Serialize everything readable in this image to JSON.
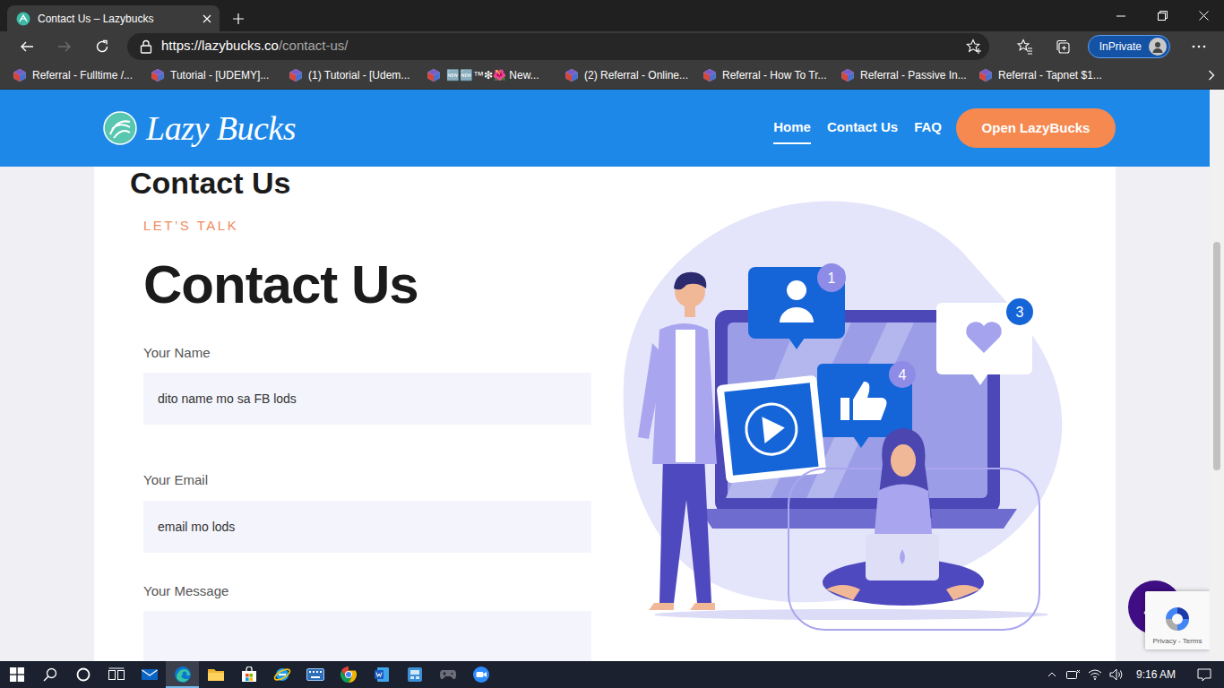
{
  "tabs": [
    {
      "label": "Contact Us – Lazybucks",
      "selected": true
    }
  ],
  "toolbar": {
    "back_enabled": true,
    "forward_enabled": false,
    "url_host": "https://lazybucks.co",
    "url_path": "/contact-us/",
    "profile": "InPrivate"
  },
  "favorites": [
    "Referral - Fulltime /...",
    "Tutorial - [UDEMY]...",
    "(1) Tutorial - [Udem...",
    "🆕🆕™❇🌺 New...",
    "(2) Referral - Online...",
    "Referral - How To Tr...",
    "Referral - Passive In...",
    "Referral - Tapnet $1..."
  ],
  "site": {
    "logo": "Lazy Bucks",
    "nav": [
      {
        "label": "Home",
        "selected": true
      },
      {
        "label": "Contact Us",
        "selected": false
      },
      {
        "label": "FAQ",
        "selected": false
      }
    ],
    "cta": "Open LazyBucks"
  },
  "contact": {
    "page_title": "Contact Us",
    "eyebrow": "LET’S TALK",
    "heading": "Contact Us",
    "fields": [
      {
        "label": "Your Name",
        "value": "dito name mo sa FB lods",
        "kind": "input"
      },
      {
        "label": "Your Email",
        "value": "email mo lods",
        "kind": "input"
      },
      {
        "label": "Your Message",
        "value": "",
        "kind": "textarea"
      }
    ]
  },
  "illustration": {
    "badges": [
      {
        "text": "1",
        "color": "#8e8ce6"
      },
      {
        "text": "3",
        "color": "#1565d8"
      },
      {
        "text": "4",
        "color": "#8e8ce6"
      }
    ]
  },
  "recaptcha": {
    "links": "Privacy - Terms"
  },
  "taskbar": {
    "apps": [
      {
        "selected": false
      },
      {
        "selected": false
      },
      {
        "selected": false
      },
      {
        "selected": false
      },
      {
        "selected": false
      },
      {
        "selected": true
      },
      {
        "selected": false
      },
      {
        "selected": false
      },
      {
        "selected": false
      },
      {
        "selected": false
      },
      {
        "selected": false
      },
      {
        "selected": false
      },
      {
        "selected": false
      },
      {
        "selected": false
      },
      {
        "selected": false
      }
    ],
    "clock": "9:16 AM"
  }
}
